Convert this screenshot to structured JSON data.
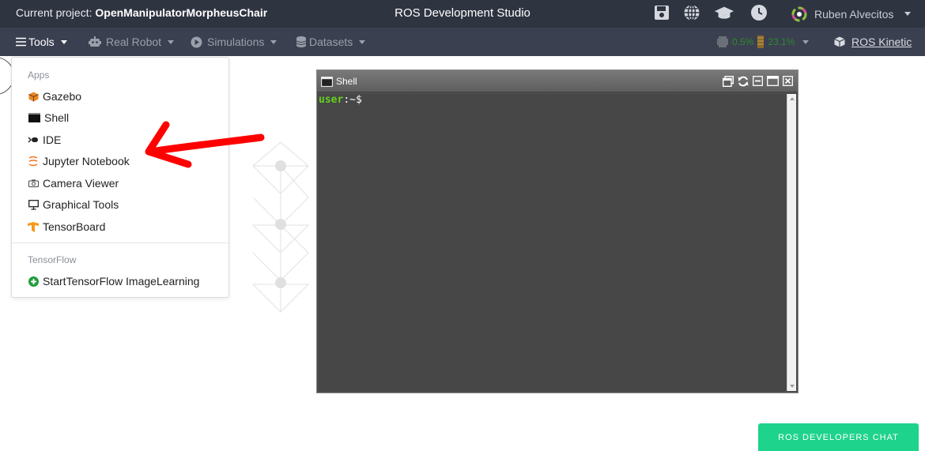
{
  "topbar": {
    "project_prefix": "Current project:",
    "project_name": "OpenManipulatorMorpheusChair",
    "title": "ROS Development Studio",
    "user_name": "Ruben Alvecitos"
  },
  "menubar": {
    "tools": "Tools",
    "real_robot": "Real Robot",
    "simulations": "Simulations",
    "datasets": "Datasets",
    "cpu": "0.5%",
    "memory": "23.1%",
    "ros_version": "ROS Kinetic"
  },
  "dropdown": {
    "apps_header": "Apps",
    "items": [
      {
        "label": "Gazebo",
        "icon": "gazebo-icon"
      },
      {
        "label": "Shell",
        "icon": "terminal-icon"
      },
      {
        "label": "IDE",
        "icon": "ide-icon"
      },
      {
        "label": "Jupyter Notebook",
        "icon": "jupyter-icon"
      },
      {
        "label": "Camera Viewer",
        "icon": "camera-icon"
      },
      {
        "label": "Graphical Tools",
        "icon": "monitor-icon"
      },
      {
        "label": "TensorBoard",
        "icon": "tensorboard-icon"
      }
    ],
    "tensorflow_header": "TensorFlow",
    "tensorflow_item": "StartTensorFlow ImageLearning"
  },
  "shell": {
    "title": "Shell",
    "prompt_user": "user",
    "prompt_rest": ":~$"
  },
  "chat": {
    "label": "ROS DEVELOPERS CHAT"
  },
  "colors": {
    "topbar": "#2f3441",
    "menubar": "#3b4050",
    "chat": "#1ed38b",
    "prompt_user": "#63d21f",
    "annotation_arrow": "#ff0000"
  }
}
